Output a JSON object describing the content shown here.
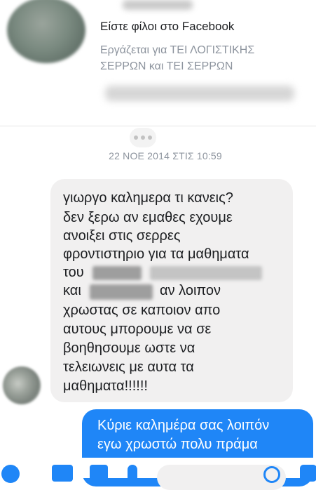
{
  "profile": {
    "friends_text": "Είστε φίλοι στο Facebook",
    "work_line1": "Εργάζεται για ΤΕΙ ΛΟΓΙΣΤΙΚΗΣ",
    "work_line2": "ΣΕΡΡΩΝ και ΤΕΙ ΣΕΡΡΩΝ"
  },
  "conversation": {
    "timestamp": "22 ΝΟΕ 2014 ΣΤΙΣ 10:59",
    "incoming": {
      "lines": [
        "γιωργο καλημερα τι κανεις?",
        "δεν ξερω αν εμαθες εχουμε",
        "ανοιξει στις σερρες",
        "φροντιστηριο για τα μαθηματα",
        "του",
        "και",
        "αν λοιπον",
        "χρωστας σε καποιον απο",
        "αυτους μπορουμε να σε",
        "βοηθησουμε ωστε να",
        "τελειωνεις με αυτα τα",
        "μαθηματα!!!!!!"
      ]
    },
    "outgoing": {
      "lines": [
        "Κύριε καλημέρα σας λοιπόν",
        "εγω χρωστώ πολυ πράμα"
      ]
    }
  },
  "colors": {
    "accent": "#1f86f7",
    "incoming_bubble": "#f1f0f0",
    "muted_text": "#8d949e"
  }
}
